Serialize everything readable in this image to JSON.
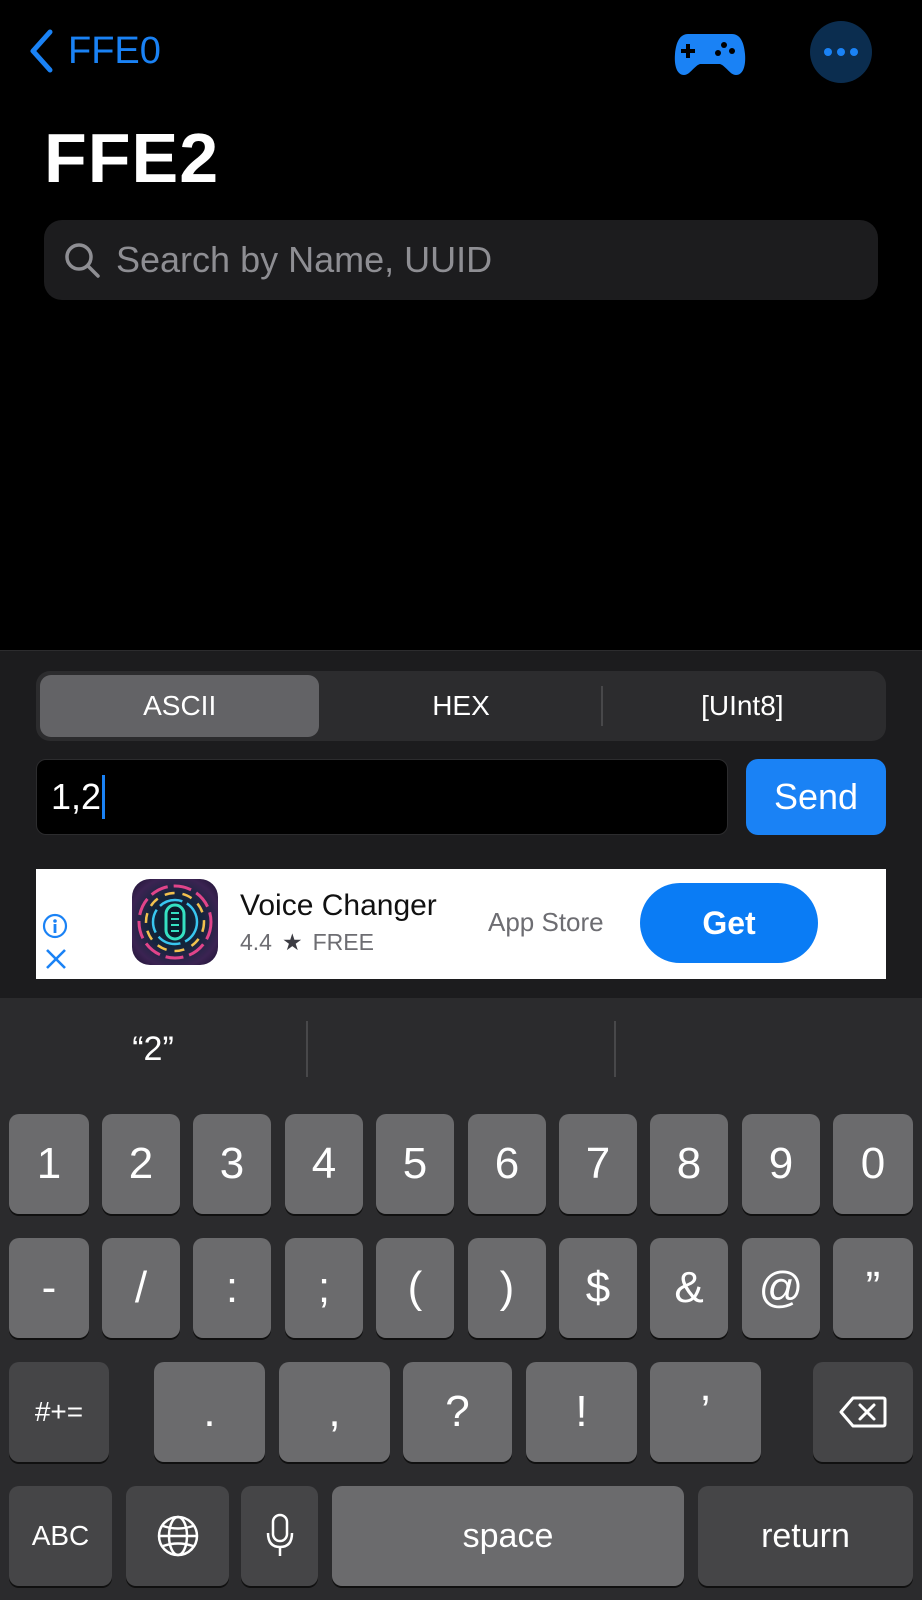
{
  "nav": {
    "back_label": "FFE0",
    "title": "FFE2",
    "accent_color": "#1a82f5"
  },
  "search": {
    "placeholder": "Search by Name, UUID",
    "value": ""
  },
  "format_tabs": [
    {
      "label": "ASCII",
      "selected": true
    },
    {
      "label": "HEX",
      "selected": false
    },
    {
      "label": "[UInt8]",
      "selected": false
    }
  ],
  "write": {
    "value": "1,2",
    "send_label": "Send"
  },
  "ad": {
    "app_name": "Voice Changer",
    "rating": "4.4",
    "star": "★",
    "price": "FREE",
    "store": "App Store",
    "cta": "Get"
  },
  "keyboard": {
    "suggestion": "“2”",
    "row1": [
      "1",
      "2",
      "3",
      "4",
      "5",
      "6",
      "7",
      "8",
      "9",
      "0"
    ],
    "row2": [
      "-",
      "/",
      ":",
      ";",
      "(",
      ")",
      "$",
      "&",
      "@",
      "”"
    ],
    "row3": [
      ".",
      ",",
      "?",
      "!",
      "’"
    ],
    "symbols_label": "#+=",
    "abc_label": "ABC",
    "space_label": "space",
    "return_label": "return"
  }
}
